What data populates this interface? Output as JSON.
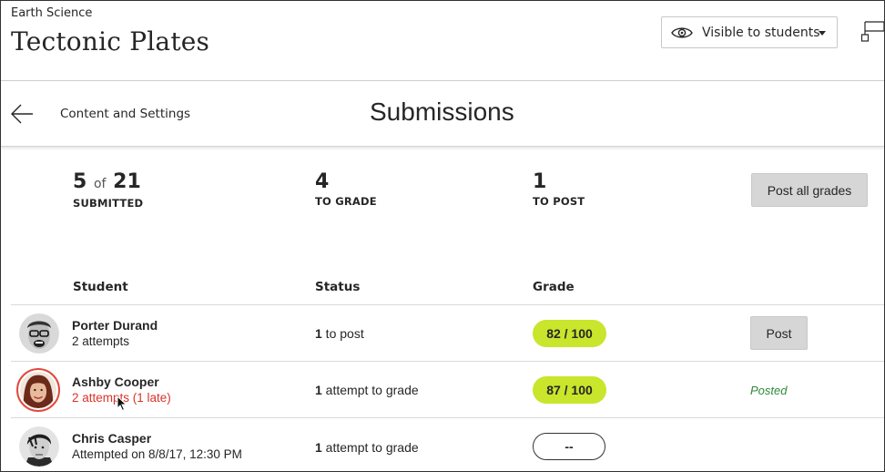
{
  "header": {
    "course_name": "Earth Science",
    "title": "Tectonic Plates",
    "visibility_label": "Visible to students",
    "visibility_icon": "eye-icon",
    "flag_icon": "flag-icon"
  },
  "nav": {
    "back_icon": "arrow-left-icon",
    "back_label": "Content and Settings",
    "section_title": "Submissions"
  },
  "stats": {
    "submitted": {
      "value": "5",
      "of_label": "of",
      "total": "21",
      "caption": "SUBMITTED"
    },
    "to_grade": {
      "value": "4",
      "caption": "TO GRADE"
    },
    "to_post": {
      "value": "1",
      "caption": "TO POST"
    },
    "post_all_label": "Post all grades"
  },
  "table": {
    "headers": {
      "student": "Student",
      "status": "Status",
      "grade": "Grade"
    },
    "rows": [
      {
        "name": "Porter Durand",
        "detail": "2 attempts",
        "status_count": "1",
        "status_text": " to post",
        "grade": "82  /  100",
        "action": "Post"
      },
      {
        "name": "Ashby Cooper",
        "detail": "2 attempts (1 late)",
        "status_count": "1",
        "status_text": " attempt to grade",
        "grade": "87  /  100",
        "action": "Posted"
      },
      {
        "name": "Chris Casper",
        "detail": "Attempted on 8/8/17, 12:30 PM",
        "status_count": "1",
        "status_text": " attempt to grade",
        "grade": "--",
        "action": ""
      }
    ]
  },
  "colors": {
    "grade_pill": "#c9e52c",
    "late_text": "#d9342b",
    "posted_text": "#2f8a3c",
    "avatar_ring": "#e14a3d",
    "button_gray": "#d6d6d6"
  }
}
